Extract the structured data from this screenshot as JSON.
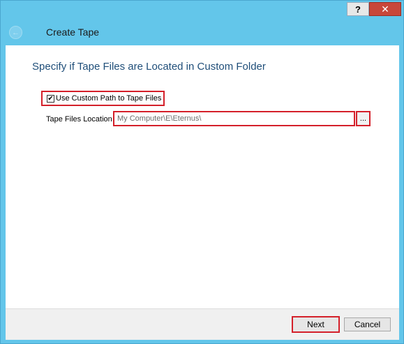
{
  "window": {
    "title": "Create Tape",
    "help_label": "?",
    "close_label": "✕",
    "back_icon": "back-arrow-icon"
  },
  "page": {
    "heading": "Specify if Tape Files are Located in Custom Folder"
  },
  "custom_path": {
    "checkbox_label": "Use Custom Path to Tape Files",
    "checked": true,
    "check_mark": "✔"
  },
  "location": {
    "label": "Tape Files Location",
    "value": "My Computer\\E\\Eternus\\",
    "browse_label": "..."
  },
  "footer": {
    "next_label": "Next",
    "cancel_label": "Cancel"
  },
  "colors": {
    "frame": "#63c6ea",
    "highlight": "#d4202a",
    "heading": "#1f4e79",
    "close": "#c8473a"
  }
}
